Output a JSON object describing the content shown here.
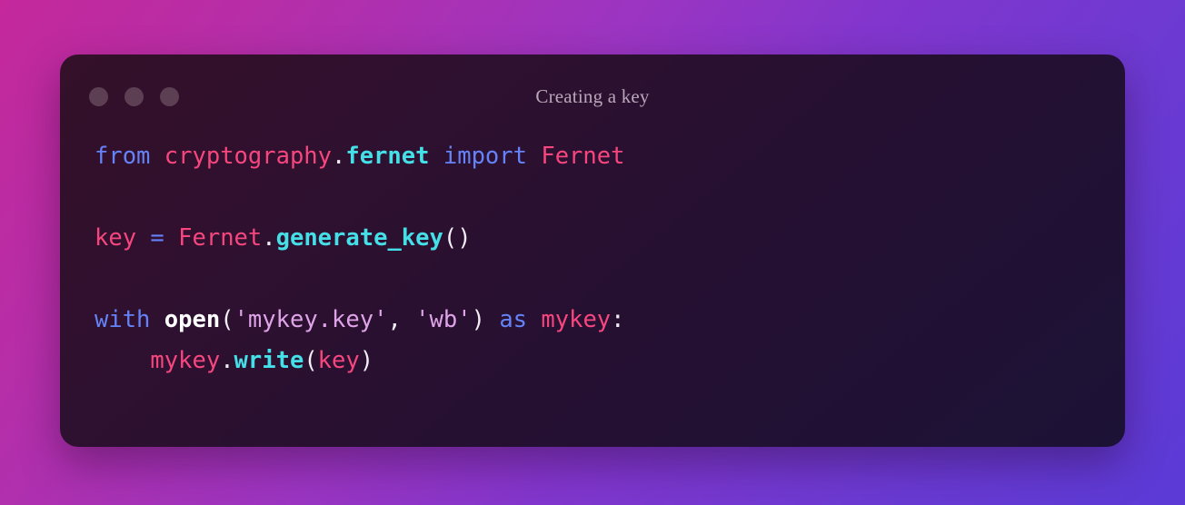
{
  "window": {
    "title": "Creating a key",
    "dots": [
      {
        "name": "close-dot"
      },
      {
        "name": "minimize-dot"
      },
      {
        "name": "maximize-dot"
      }
    ],
    "dot_color": "#5c3f53",
    "card_background": "#2a1030"
  },
  "background": {
    "gradient_from": "#c4289b",
    "gradient_mid": "#8236cd",
    "gradient_to": "#5b3ad6"
  },
  "theme": {
    "keyword_color": "#6583f8",
    "name_color": "#f7467e",
    "method_color": "#45dfe8",
    "string_color": "#dfa3e8",
    "plain_color": "#f2eef6",
    "builtin_color": "#ffffff",
    "title_color": "#b9a7b8"
  },
  "code": {
    "language": "python",
    "raw": "from cryptography.fernet import Fernet\n\nkey = Fernet.generate_key()\n\nwith open('mykey.key', 'wb') as mykey:\n    mykey.write(key)",
    "lines": [
      {
        "index": 1,
        "text": "from cryptography.fernet import Fernet",
        "tokens": [
          {
            "t": "from",
            "c": "kw"
          },
          {
            "t": " ",
            "c": "plain"
          },
          {
            "t": "cryptography",
            "c": "name"
          },
          {
            "t": ".",
            "c": "dot"
          },
          {
            "t": "fernet",
            "c": "cyan"
          },
          {
            "t": " ",
            "c": "plain"
          },
          {
            "t": "import",
            "c": "kw"
          },
          {
            "t": " ",
            "c": "plain"
          },
          {
            "t": "Fernet",
            "c": "name"
          }
        ]
      },
      {
        "index": 2,
        "text": "",
        "tokens": []
      },
      {
        "index": 3,
        "text": "key = Fernet.generate_key()",
        "tokens": [
          {
            "t": "key",
            "c": "name"
          },
          {
            "t": " ",
            "c": "plain"
          },
          {
            "t": "=",
            "c": "op"
          },
          {
            "t": " ",
            "c": "plain"
          },
          {
            "t": "Fernet",
            "c": "name"
          },
          {
            "t": ".",
            "c": "dot"
          },
          {
            "t": "generate_key",
            "c": "method"
          },
          {
            "t": "()",
            "c": "punc"
          }
        ]
      },
      {
        "index": 4,
        "text": "",
        "tokens": []
      },
      {
        "index": 5,
        "text": "with open('mykey.key', 'wb') as mykey:",
        "tokens": [
          {
            "t": "with",
            "c": "kw"
          },
          {
            "t": " ",
            "c": "plain"
          },
          {
            "t": "open",
            "c": "builtin"
          },
          {
            "t": "(",
            "c": "punc"
          },
          {
            "t": "'mykey.key'",
            "c": "string"
          },
          {
            "t": ",",
            "c": "punc"
          },
          {
            "t": " ",
            "c": "plain"
          },
          {
            "t": "'wb'",
            "c": "string"
          },
          {
            "t": ")",
            "c": "punc"
          },
          {
            "t": " ",
            "c": "plain"
          },
          {
            "t": "as",
            "c": "kw"
          },
          {
            "t": " ",
            "c": "plain"
          },
          {
            "t": "mykey",
            "c": "name"
          },
          {
            "t": ":",
            "c": "punc"
          }
        ]
      },
      {
        "index": 6,
        "text": "    mykey.write(key)",
        "tokens": [
          {
            "t": "    ",
            "c": "plain"
          },
          {
            "t": "mykey",
            "c": "name"
          },
          {
            "t": ".",
            "c": "dot"
          },
          {
            "t": "write",
            "c": "method"
          },
          {
            "t": "(",
            "c": "punc"
          },
          {
            "t": "key",
            "c": "name"
          },
          {
            "t": ")",
            "c": "punc"
          }
        ]
      }
    ]
  }
}
